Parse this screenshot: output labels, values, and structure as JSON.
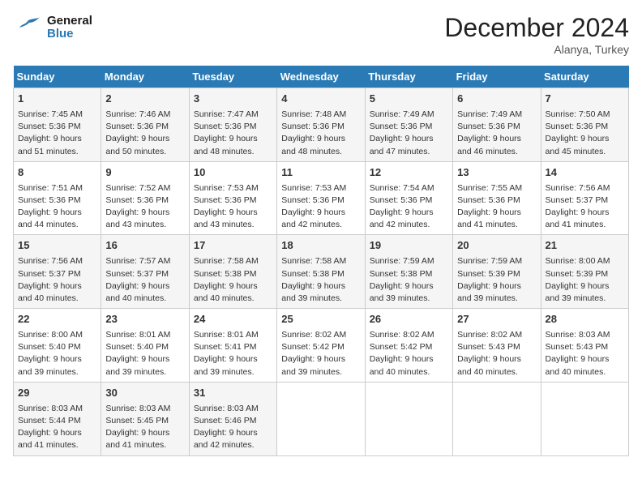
{
  "header": {
    "logo_line1": "General",
    "logo_line2": "Blue",
    "month": "December 2024",
    "location": "Alanya, Turkey"
  },
  "calendar": {
    "days_of_week": [
      "Sunday",
      "Monday",
      "Tuesday",
      "Wednesday",
      "Thursday",
      "Friday",
      "Saturday"
    ],
    "weeks": [
      [
        {
          "day": "",
          "info": ""
        },
        {
          "day": "2",
          "info": "Sunrise: 7:46 AM\nSunset: 5:36 PM\nDaylight: 9 hours\nand 50 minutes."
        },
        {
          "day": "3",
          "info": "Sunrise: 7:47 AM\nSunset: 5:36 PM\nDaylight: 9 hours\nand 48 minutes."
        },
        {
          "day": "4",
          "info": "Sunrise: 7:48 AM\nSunset: 5:36 PM\nDaylight: 9 hours\nand 48 minutes."
        },
        {
          "day": "5",
          "info": "Sunrise: 7:49 AM\nSunset: 5:36 PM\nDaylight: 9 hours\nand 47 minutes."
        },
        {
          "day": "6",
          "info": "Sunrise: 7:49 AM\nSunset: 5:36 PM\nDaylight: 9 hours\nand 46 minutes."
        },
        {
          "day": "7",
          "info": "Sunrise: 7:50 AM\nSunset: 5:36 PM\nDaylight: 9 hours\nand 45 minutes."
        }
      ],
      [
        {
          "day": "1",
          "info": "Sunrise: 7:45 AM\nSunset: 5:36 PM\nDaylight: 9 hours\nand 51 minutes."
        },
        {
          "day": "",
          "info": ""
        },
        {
          "day": "",
          "info": ""
        },
        {
          "day": "",
          "info": ""
        },
        {
          "day": "",
          "info": ""
        },
        {
          "day": "",
          "info": ""
        },
        {
          "day": ""
        }
      ],
      [
        {
          "day": "8",
          "info": "Sunrise: 7:51 AM\nSunset: 5:36 PM\nDaylight: 9 hours\nand 44 minutes."
        },
        {
          "day": "9",
          "info": "Sunrise: 7:52 AM\nSunset: 5:36 PM\nDaylight: 9 hours\nand 43 minutes."
        },
        {
          "day": "10",
          "info": "Sunrise: 7:53 AM\nSunset: 5:36 PM\nDaylight: 9 hours\nand 43 minutes."
        },
        {
          "day": "11",
          "info": "Sunrise: 7:53 AM\nSunset: 5:36 PM\nDaylight: 9 hours\nand 42 minutes."
        },
        {
          "day": "12",
          "info": "Sunrise: 7:54 AM\nSunset: 5:36 PM\nDaylight: 9 hours\nand 42 minutes."
        },
        {
          "day": "13",
          "info": "Sunrise: 7:55 AM\nSunset: 5:36 PM\nDaylight: 9 hours\nand 41 minutes."
        },
        {
          "day": "14",
          "info": "Sunrise: 7:56 AM\nSunset: 5:37 PM\nDaylight: 9 hours\nand 41 minutes."
        }
      ],
      [
        {
          "day": "15",
          "info": "Sunrise: 7:56 AM\nSunset: 5:37 PM\nDaylight: 9 hours\nand 40 minutes."
        },
        {
          "day": "16",
          "info": "Sunrise: 7:57 AM\nSunset: 5:37 PM\nDaylight: 9 hours\nand 40 minutes."
        },
        {
          "day": "17",
          "info": "Sunrise: 7:58 AM\nSunset: 5:38 PM\nDaylight: 9 hours\nand 40 minutes."
        },
        {
          "day": "18",
          "info": "Sunrise: 7:58 AM\nSunset: 5:38 PM\nDaylight: 9 hours\nand 39 minutes."
        },
        {
          "day": "19",
          "info": "Sunrise: 7:59 AM\nSunset: 5:38 PM\nDaylight: 9 hours\nand 39 minutes."
        },
        {
          "day": "20",
          "info": "Sunrise: 7:59 AM\nSunset: 5:39 PM\nDaylight: 9 hours\nand 39 minutes."
        },
        {
          "day": "21",
          "info": "Sunrise: 8:00 AM\nSunset: 5:39 PM\nDaylight: 9 hours\nand 39 minutes."
        }
      ],
      [
        {
          "day": "22",
          "info": "Sunrise: 8:00 AM\nSunset: 5:40 PM\nDaylight: 9 hours\nand 39 minutes."
        },
        {
          "day": "23",
          "info": "Sunrise: 8:01 AM\nSunset: 5:40 PM\nDaylight: 9 hours\nand 39 minutes."
        },
        {
          "day": "24",
          "info": "Sunrise: 8:01 AM\nSunset: 5:41 PM\nDaylight: 9 hours\nand 39 minutes."
        },
        {
          "day": "25",
          "info": "Sunrise: 8:02 AM\nSunset: 5:42 PM\nDaylight: 9 hours\nand 39 minutes."
        },
        {
          "day": "26",
          "info": "Sunrise: 8:02 AM\nSunset: 5:42 PM\nDaylight: 9 hours\nand 40 minutes."
        },
        {
          "day": "27",
          "info": "Sunrise: 8:02 AM\nSunset: 5:43 PM\nDaylight: 9 hours\nand 40 minutes."
        },
        {
          "day": "28",
          "info": "Sunrise: 8:03 AM\nSunset: 5:43 PM\nDaylight: 9 hours\nand 40 minutes."
        }
      ],
      [
        {
          "day": "29",
          "info": "Sunrise: 8:03 AM\nSunset: 5:44 PM\nDaylight: 9 hours\nand 41 minutes."
        },
        {
          "day": "30",
          "info": "Sunrise: 8:03 AM\nSunset: 5:45 PM\nDaylight: 9 hours\nand 41 minutes."
        },
        {
          "day": "31",
          "info": "Sunrise: 8:03 AM\nSunset: 5:46 PM\nDaylight: 9 hours\nand 42 minutes."
        },
        {
          "day": "",
          "info": ""
        },
        {
          "day": "",
          "info": ""
        },
        {
          "day": "",
          "info": ""
        },
        {
          "day": "",
          "info": ""
        }
      ]
    ]
  }
}
